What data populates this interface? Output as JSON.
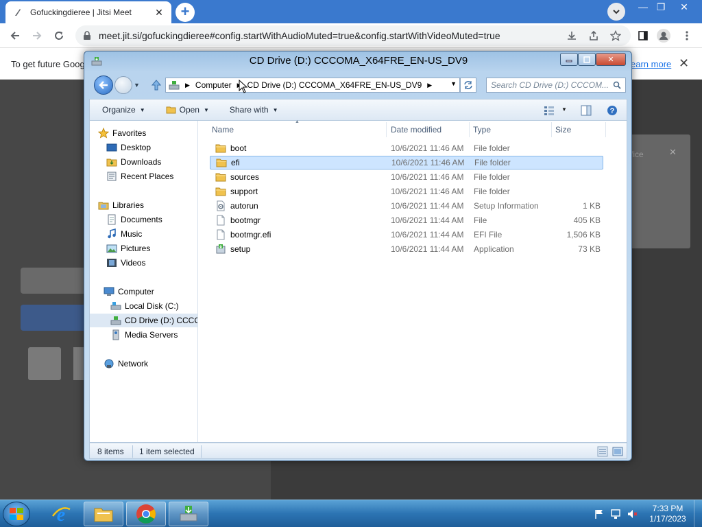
{
  "browser": {
    "tab_title": "Gofuckingdieree | Jitsi Meet",
    "url": "meet.jit.si/gofuckingdieree#config.startWithAudioMuted=true&config.startWithVideoMuted=true"
  },
  "infobar": {
    "message": "To get future Goog",
    "learn_more": "earn more"
  },
  "page": {
    "card_text": "fice"
  },
  "explorer": {
    "title": "CD Drive (D:) CCCOMA_X64FRE_EN-US_DV9",
    "breadcrumb": [
      "Computer",
      "CD Drive (D:) CCCOMA_X64FRE_EN-US_DV9"
    ],
    "search_placeholder": "Search CD Drive (D:) CCCOM...",
    "commands": {
      "organize": "Organize",
      "open": "Open",
      "share_with": "Share with"
    },
    "nav": {
      "favorites": "Favorites",
      "desktop": "Desktop",
      "downloads": "Downloads",
      "recent_places": "Recent Places",
      "libraries": "Libraries",
      "documents": "Documents",
      "music": "Music",
      "pictures": "Pictures",
      "videos": "Videos",
      "computer": "Computer",
      "local_disk": "Local Disk (C:)",
      "cd_drive": "CD Drive (D:) CCCOI",
      "media_servers": "Media Servers",
      "network": "Network"
    },
    "columns": {
      "name": "Name",
      "date_modified": "Date modified",
      "type": "Type",
      "size": "Size"
    },
    "files": [
      {
        "name": "boot",
        "date": "10/6/2021 11:46 AM",
        "type": "File folder",
        "size": "",
        "icon": "folder-icon"
      },
      {
        "name": "efi",
        "date": "10/6/2021 11:46 AM",
        "type": "File folder",
        "size": "",
        "icon": "folder-icon"
      },
      {
        "name": "sources",
        "date": "10/6/2021 11:46 AM",
        "type": "File folder",
        "size": "",
        "icon": "folder-icon"
      },
      {
        "name": "support",
        "date": "10/6/2021 11:46 AM",
        "type": "File folder",
        "size": "",
        "icon": "folder-icon"
      },
      {
        "name": "autorun",
        "date": "10/6/2021 11:44 AM",
        "type": "Setup Information",
        "size": "1 KB",
        "icon": "settings-file-icon"
      },
      {
        "name": "bootmgr",
        "date": "10/6/2021 11:44 AM",
        "type": "File",
        "size": "405 KB",
        "icon": "file-icon"
      },
      {
        "name": "bootmgr.efi",
        "date": "10/6/2021 11:44 AM",
        "type": "EFI File",
        "size": "1,506 KB",
        "icon": "file-icon"
      },
      {
        "name": "setup",
        "date": "10/6/2021 11:44 AM",
        "type": "Application",
        "size": "73 KB",
        "icon": "setup-app-icon"
      }
    ],
    "selected_file": "efi",
    "status": {
      "items": "8 items",
      "selected": "1 item selected"
    }
  },
  "taskbar": {
    "time": "7:33 PM",
    "date": "1/17/2023"
  },
  "colors": {
    "chrome_frame": "#3a79ce",
    "selection": "#cde5ff",
    "taskbar": "#2c74b3"
  }
}
